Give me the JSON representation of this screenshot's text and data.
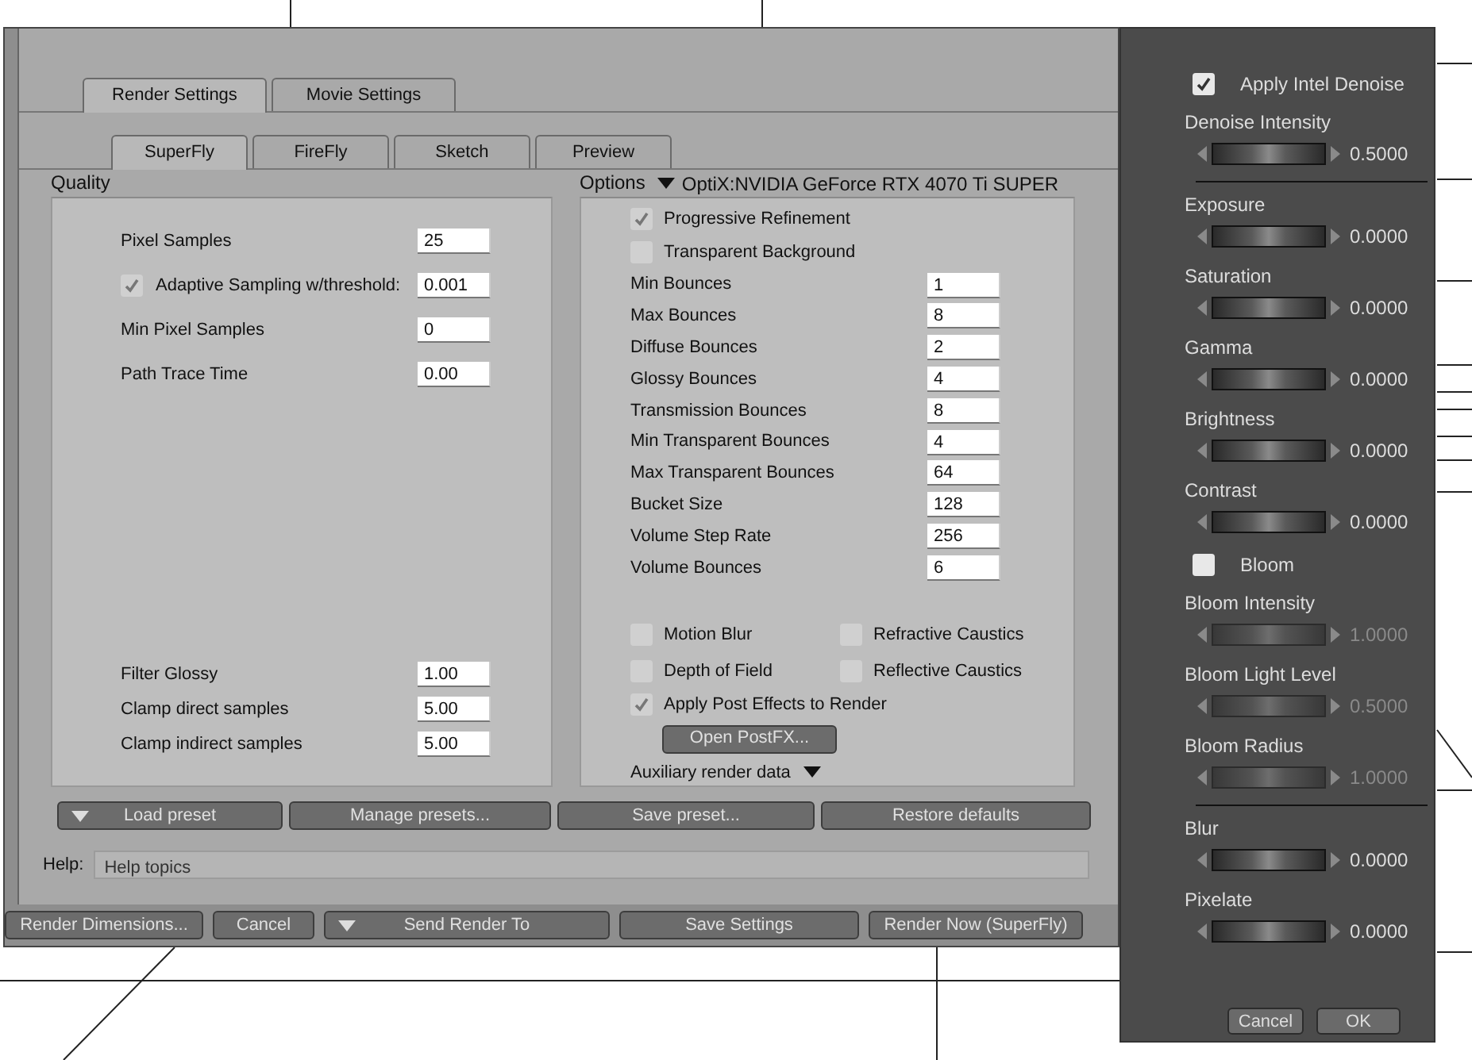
{
  "render_window": {
    "tabs": [
      {
        "label": "Render Settings",
        "selected": true
      },
      {
        "label": "Movie Settings",
        "selected": false
      }
    ],
    "engine_tabs": [
      {
        "label": "SuperFly",
        "selected": true
      },
      {
        "label": "FireFly",
        "selected": false
      },
      {
        "label": "Sketch",
        "selected": false
      },
      {
        "label": "Preview",
        "selected": false
      }
    ],
    "quality": {
      "title": "Quality",
      "fields_top": [
        {
          "kind": "field",
          "label": "Pixel Samples",
          "value": "25"
        },
        {
          "kind": "check-field",
          "label": "Adaptive Sampling w/threshold:",
          "value": "0.001",
          "checked": true
        },
        {
          "kind": "field",
          "label": "Min Pixel Samples",
          "value": "0"
        },
        {
          "kind": "field",
          "label": "Path Trace Time",
          "value": "0.00"
        }
      ],
      "fields_bottom": [
        {
          "kind": "field",
          "label": "Filter Glossy",
          "value": "1.00"
        },
        {
          "kind": "field",
          "label": "Clamp direct samples",
          "value": "5.00"
        },
        {
          "kind": "field",
          "label": "Clamp indirect samples",
          "value": "5.00"
        }
      ]
    },
    "options": {
      "title": "Options",
      "device": "OptiX:NVIDIA GeForce RTX 4070 Ti SUPER",
      "checks_top": [
        {
          "label": "Progressive Refinement",
          "checked": true
        },
        {
          "label": "Transparent Background",
          "checked": false
        }
      ],
      "fields": [
        {
          "label": "Min Bounces",
          "value": "1"
        },
        {
          "label": "Max Bounces",
          "value": "8"
        },
        {
          "label": "Diffuse Bounces",
          "value": "2"
        },
        {
          "label": "Glossy Bounces",
          "value": "4"
        },
        {
          "label": "Transmission Bounces",
          "value": "8"
        },
        {
          "label": "Min Transparent Bounces",
          "value": "4"
        },
        {
          "label": "Max Transparent Bounces",
          "value": "64"
        },
        {
          "label": "Bucket Size",
          "value": "128"
        },
        {
          "label": "Volume Step Rate",
          "value": "256"
        },
        {
          "label": "Volume Bounces",
          "value": "6"
        }
      ],
      "checks_grid": [
        {
          "label": "Motion Blur",
          "checked": false
        },
        {
          "label": "Refractive Caustics",
          "checked": false
        },
        {
          "label": "Depth of Field",
          "checked": false
        },
        {
          "label": "Reflective Caustics",
          "checked": false
        }
      ],
      "post_effects": {
        "label": "Apply Post Effects to Render",
        "checked": true
      },
      "postfx_button": "Open PostFX...",
      "auxiliary": "Auxiliary render data"
    },
    "preset_buttons": [
      {
        "label": "Load preset",
        "kind": "dropdown"
      },
      {
        "label": "Manage presets...",
        "kind": "plain"
      },
      {
        "label": "Save preset...",
        "kind": "plain"
      },
      {
        "label": "Restore defaults",
        "kind": "plain"
      }
    ],
    "help": {
      "label": "Help:",
      "value": "Help topics"
    },
    "bottom_buttons": [
      {
        "label": "Render Dimensions...",
        "kind": "plain"
      },
      {
        "label": "Cancel",
        "kind": "plain"
      },
      {
        "label": "Send Render To",
        "kind": "dropdown"
      },
      {
        "label": "Save Settings",
        "kind": "plain"
      },
      {
        "label": "Render Now (SuperFly)",
        "kind": "plain"
      }
    ]
  },
  "postfx_panel": {
    "items": [
      {
        "kind": "checkbox",
        "label": "Apply Intel Denoise",
        "checked": true
      },
      {
        "kind": "slider",
        "label": "Denoise Intensity",
        "reading": "0.5000",
        "disabled": false
      },
      {
        "kind": "divider"
      },
      {
        "kind": "slider",
        "label": "Exposure",
        "reading": "0.0000",
        "disabled": false
      },
      {
        "kind": "slider",
        "label": "Saturation",
        "reading": "0.0000",
        "disabled": false
      },
      {
        "kind": "slider",
        "label": "Gamma",
        "reading": "0.0000",
        "disabled": false
      },
      {
        "kind": "slider",
        "label": "Brightness",
        "reading": "0.0000",
        "disabled": false
      },
      {
        "kind": "slider",
        "label": "Contrast",
        "reading": "0.0000",
        "disabled": false
      },
      {
        "kind": "checkbox",
        "label": "Bloom",
        "checked": false
      },
      {
        "kind": "slider",
        "label": "Bloom Intensity",
        "reading": "1.0000",
        "disabled": true
      },
      {
        "kind": "slider",
        "label": "Bloom Light Level",
        "reading": "0.5000",
        "disabled": true
      },
      {
        "kind": "slider",
        "label": "Bloom Radius",
        "reading": "1.0000",
        "disabled": true
      },
      {
        "kind": "divider"
      },
      {
        "kind": "slider",
        "label": "Blur",
        "reading": "0.0000",
        "disabled": false
      },
      {
        "kind": "slider",
        "label": "Pixelate",
        "reading": "0.0000",
        "disabled": false
      }
    ],
    "buttons": [
      "Cancel",
      "OK"
    ]
  }
}
